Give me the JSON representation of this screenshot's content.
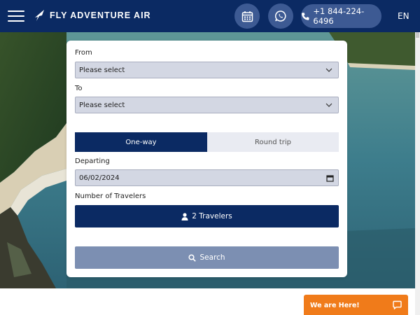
{
  "brand": {
    "name": "FLY ADVENTURE AIR",
    "primary": "#0b2a63",
    "accent": "#f07b1a"
  },
  "header": {
    "menu_icon": "hamburger-icon",
    "calendar_icon": "calendar-icon",
    "whatsapp_icon": "whatsapp-icon",
    "phone": "+1 844-224-6496",
    "language": "EN"
  },
  "form": {
    "from_label": "From",
    "from_value": "Please select",
    "to_label": "To",
    "to_value": "Please select",
    "trip_types": [
      {
        "label": "One-way",
        "active": true
      },
      {
        "label": "Round trip",
        "active": false
      }
    ],
    "departing_label": "Departing",
    "departing_value": "06/02/2024",
    "travelers_label": "Number of Travelers",
    "travelers_value": "2 Travelers",
    "search_label": "Search"
  },
  "chat": {
    "label": "We are Here!",
    "icon": "chat-bubble-icon"
  }
}
